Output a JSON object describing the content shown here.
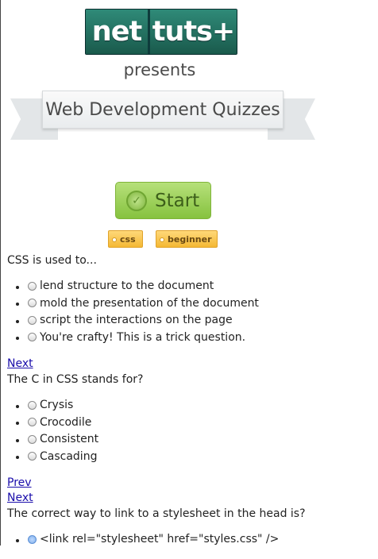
{
  "brand": {
    "logo_left": "net",
    "logo_right": "tuts+",
    "presents": "presents"
  },
  "banner": {
    "title": "Web Development Quizzes"
  },
  "start_button": {
    "label": "Start"
  },
  "tags": [
    "css",
    "beginner"
  ],
  "questions": [
    {
      "text": "CSS is used to...",
      "options": [
        "lend structure to the document",
        "mold the presentation of the document",
        "script the interactions on the page",
        "You're crafty! This is a trick question."
      ]
    },
    {
      "text": "The C in CSS stands for?",
      "options": [
        "Crysis",
        "Crocodile",
        "Consistent",
        "Cascading"
      ]
    },
    {
      "text": "The correct way to link to a stylesheet in the head is?",
      "options": [
        "<link rel=\"stylesheet\" href=\"styles.css\" />"
      ]
    }
  ],
  "nav": {
    "next": "Next",
    "prev": "Prev"
  }
}
